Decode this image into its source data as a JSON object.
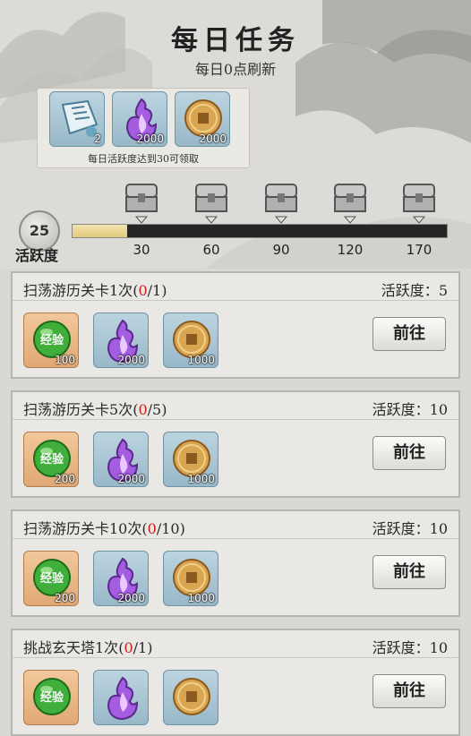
{
  "header": {
    "title": "每日任务",
    "subtitle": "每日0点刷新"
  },
  "reward_preview": {
    "items": [
      {
        "icon": "scroll-chest-icon",
        "qty": "2"
      },
      {
        "icon": "purple-flame-icon",
        "qty": "2000"
      },
      {
        "icon": "copper-coin-icon",
        "qty": "2000"
      }
    ],
    "caption": "每日活跃度达到30可领取"
  },
  "activity": {
    "current": "25",
    "label": "活跃度",
    "progress_fraction": 0.147,
    "milestones": [
      "30",
      "60",
      "90",
      "120",
      "170"
    ]
  },
  "tasks": [
    {
      "name": "扫荡游历关卡1次",
      "progress_open": "(",
      "progress_done": "0",
      "progress_total": "/1)",
      "activity_label": "活跃度：",
      "activity_value": "5",
      "rewards": [
        {
          "icon": "exp-orb-icon",
          "text": "经验",
          "qty": "100"
        },
        {
          "icon": "purple-flame-icon",
          "qty": "2000"
        },
        {
          "icon": "copper-coin-icon",
          "qty": "1000"
        }
      ],
      "button": "前往"
    },
    {
      "name": "扫荡游历关卡5次",
      "progress_open": "(",
      "progress_done": "0",
      "progress_total": "/5)",
      "activity_label": "活跃度：",
      "activity_value": "10",
      "rewards": [
        {
          "icon": "exp-orb-icon",
          "text": "经验",
          "qty": "200"
        },
        {
          "icon": "purple-flame-icon",
          "qty": "2000"
        },
        {
          "icon": "copper-coin-icon",
          "qty": "1000"
        }
      ],
      "button": "前往"
    },
    {
      "name": "扫荡游历关卡10次",
      "progress_open": "(",
      "progress_done": "0",
      "progress_total": "/10)",
      "activity_label": "活跃度：",
      "activity_value": "10",
      "rewards": [
        {
          "icon": "exp-orb-icon",
          "text": "经验",
          "qty": "200"
        },
        {
          "icon": "purple-flame-icon",
          "qty": "2000"
        },
        {
          "icon": "copper-coin-icon",
          "qty": "1000"
        }
      ],
      "button": "前往"
    },
    {
      "name": "挑战玄天塔1次",
      "progress_open": "(",
      "progress_done": "0",
      "progress_total": "/1)",
      "activity_label": "活跃度：",
      "activity_value": "10",
      "rewards": [
        {
          "icon": "exp-orb-icon",
          "text": "经验",
          "qty": ""
        },
        {
          "icon": "purple-flame-icon",
          "qty": ""
        },
        {
          "icon": "copper-coin-icon",
          "qty": ""
        }
      ],
      "button": "前往"
    }
  ],
  "colors": {
    "progress_fill": "#e3c97c",
    "progress_red": "#d21b1b",
    "exp_tile": "#e0a876",
    "item_tile": "#98b8c8"
  }
}
